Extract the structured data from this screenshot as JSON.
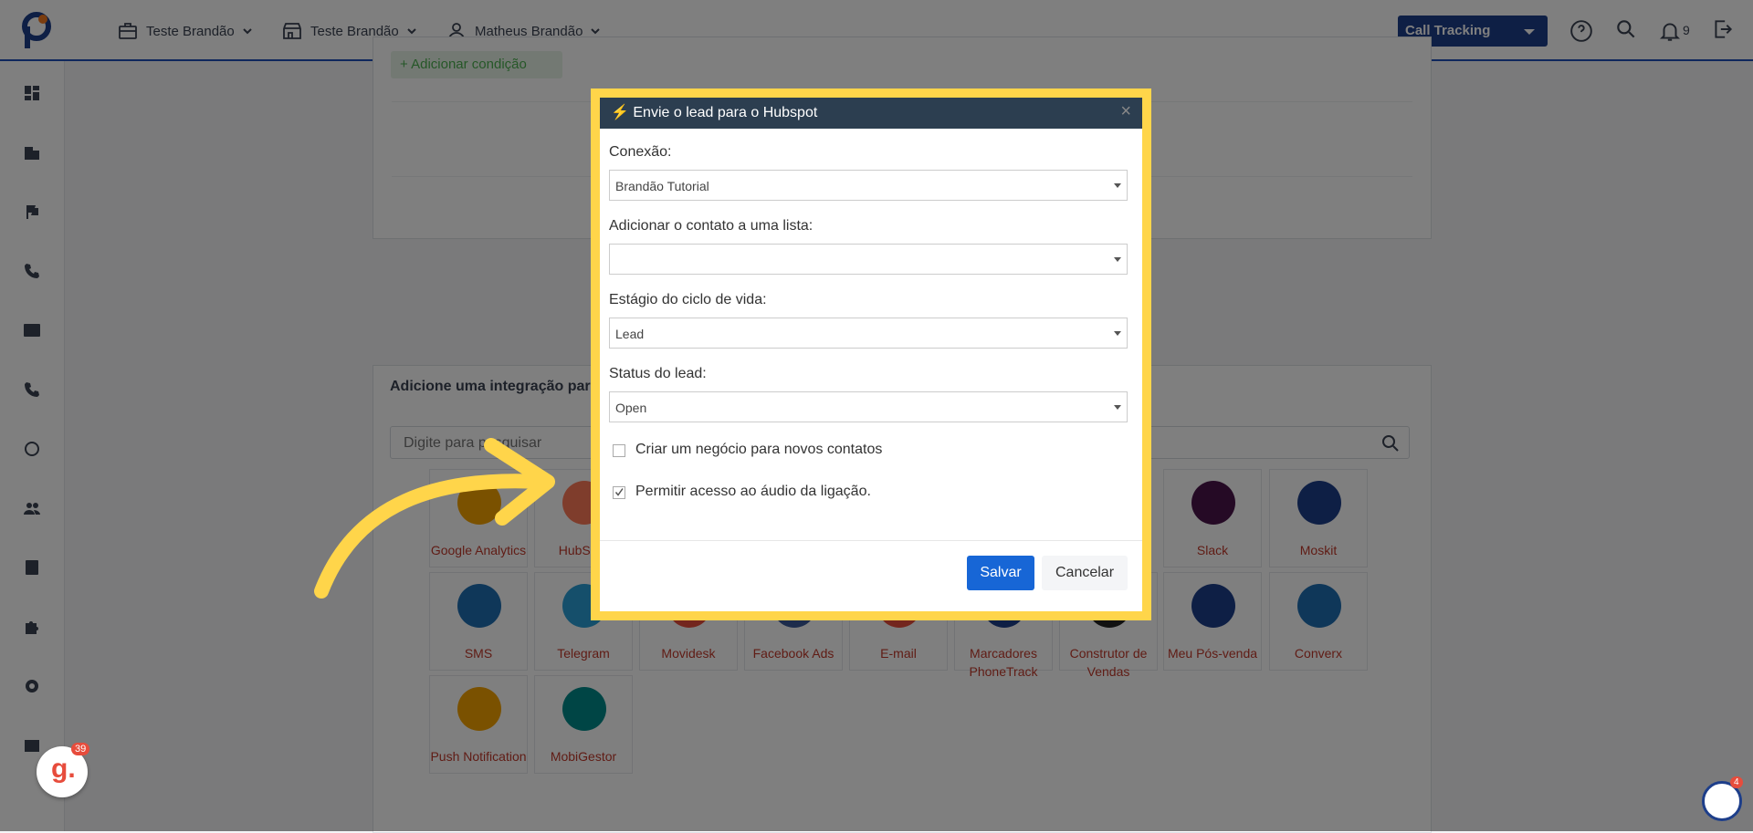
{
  "header": {
    "nav": [
      {
        "label": "Teste Brandão",
        "icon": "briefcase-icon"
      },
      {
        "label": "Teste Brandão",
        "icon": "store-icon"
      },
      {
        "label": "Matheus Brandão",
        "icon": "user-icon"
      }
    ],
    "product_select": "Call Tracking",
    "notification_count": "9"
  },
  "page": {
    "add_condition": "+ Adicionar condição",
    "integration_title": "Adicione uma integração para",
    "search_placeholder": "Digite para pesquisar"
  },
  "integrations": [
    {
      "label": "Google Analytics",
      "color": "#f4a300"
    },
    {
      "label": "HubSpot",
      "color": "#ff7a59"
    },
    {
      "label": "Slack",
      "color": "#4a154b"
    },
    {
      "label": "Moskit",
      "color": "#1d3e8a"
    },
    {
      "label": "SMS",
      "color": "#1f6fb2"
    },
    {
      "label": "Telegram",
      "color": "#2a9fd6"
    },
    {
      "label": "Movidesk",
      "color": "#e74c3c"
    },
    {
      "label": "Facebook Ads",
      "color": "#3b5998"
    },
    {
      "label": "E-mail",
      "color": "#e74c3c"
    },
    {
      "label": "Marcadores PhoneTrack",
      "color": "#1d3e8a"
    },
    {
      "label": "Construtor de Vendas",
      "color": "#222222"
    },
    {
      "label": "Meu Pós-venda",
      "color": "#1d3e8a"
    },
    {
      "label": "Converx",
      "color": "#1f6fb2"
    },
    {
      "label": "Push Notification",
      "color": "#f4a300"
    },
    {
      "label": "MobiGestor",
      "color": "#008a8a"
    }
  ],
  "modal": {
    "title": "Envie o lead para o Hubspot",
    "connection_label": "Conexão:",
    "connection_value": "Brandão Tutorial",
    "list_label": "Adicionar o contato a uma lista:",
    "list_value": "",
    "lifecycle_label": "Estágio do ciclo de vida:",
    "lifecycle_value": "Lead",
    "status_label": "Status do lead:",
    "status_value": "Open",
    "create_deal_label": "Criar um negócio para novos contatos",
    "create_deal_checked": false,
    "audio_access_label": "Permitir acesso ao áudio da ligação.",
    "audio_access_checked": true,
    "save_label": "Salvar",
    "cancel_label": "Cancelar"
  },
  "widgets": {
    "g_count": "39",
    "chat_count": "4"
  },
  "colors": {
    "accent": "#1d3e8a",
    "save": "#1766d6",
    "highlight": "#ffd54a"
  }
}
